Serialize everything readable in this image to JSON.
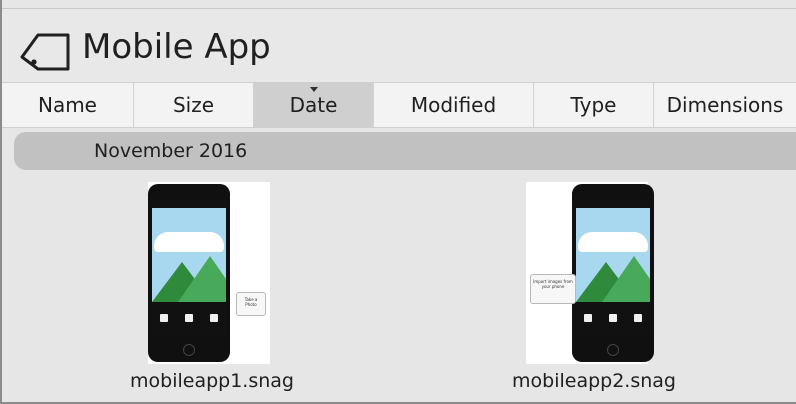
{
  "titlebar": {
    "title": "Mobile App",
    "icon": "tag-icon"
  },
  "columns": [
    {
      "label": "Name"
    },
    {
      "label": "Size"
    },
    {
      "label": "Date",
      "sorted": true
    },
    {
      "label": "Modified"
    },
    {
      "label": "Type"
    },
    {
      "label": "Dimensions"
    }
  ],
  "group": {
    "label": "November 2016"
  },
  "items": [
    {
      "filename": "mobileapp1.snag",
      "callout": "Take a Photo"
    },
    {
      "filename": "mobileapp2.snag",
      "callout": "Import images from your phone"
    }
  ],
  "colors": {
    "header_sorted": "#cfcfcf",
    "group_header": "#c1c1c1",
    "background": "#e6e6e6"
  }
}
